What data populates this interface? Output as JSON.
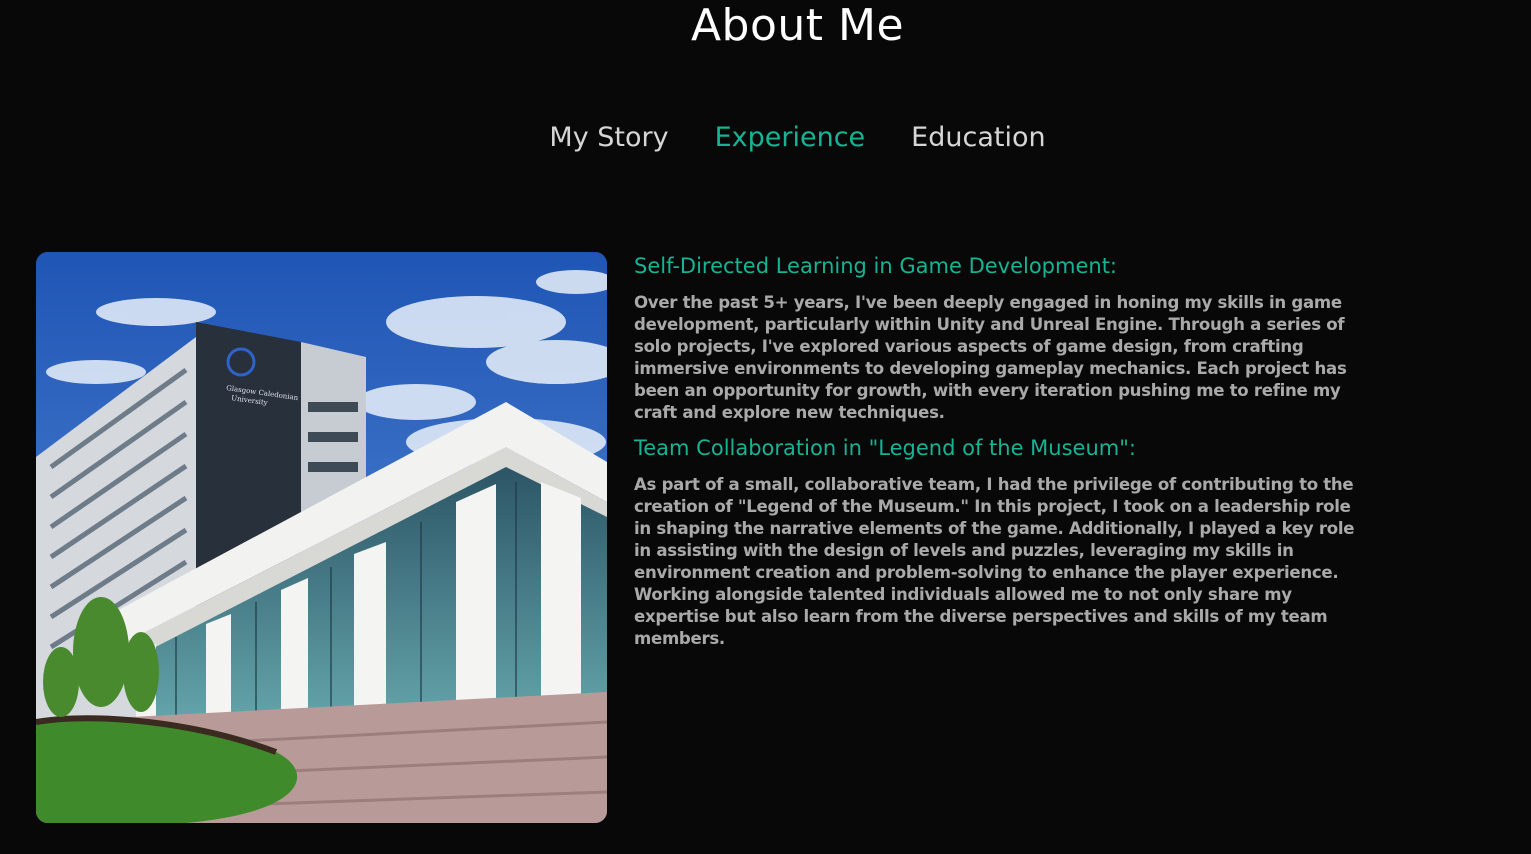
{
  "page_title": "About Me",
  "tabs": [
    {
      "label": "My Story",
      "active": false
    },
    {
      "label": "Experience",
      "active": true
    },
    {
      "label": "Education",
      "active": false
    }
  ],
  "colors": {
    "background": "#080808",
    "accent": "#16b394",
    "text_primary": "#ffffff",
    "text_muted": "#a9a9a9"
  },
  "image": {
    "description": "photo-building",
    "sign_text": "GCU Glasgow Caledonian University"
  },
  "experience": {
    "sections": [
      {
        "heading": "Self-Directed Learning in Game Development:",
        "body": "Over the past 5+ years, I've been deeply engaged in honing my skills in game development, particularly within Unity and Unreal Engine. Through a series of solo projects, I've explored various aspects of game design, from crafting immersive environments to developing gameplay mechanics. Each project has been an opportunity for growth, with every iteration pushing me to refine my craft and explore new techniques."
      },
      {
        "heading": "Team Collaboration in \"Legend of the Museum\":",
        "body": "As part of a small, collaborative team, I had the privilege of contributing to the creation of \"Legend of the Museum.\" In this project, I took on a leadership role in shaping the narrative elements of the game. Additionally, I played a key role in assisting with the design of levels and puzzles, leveraging my skills in environment creation and problem-solving to enhance the player experience. Working alongside talented individuals allowed me to not only share my expertise but also learn from the diverse perspectives and skills of my team members."
      }
    ]
  }
}
